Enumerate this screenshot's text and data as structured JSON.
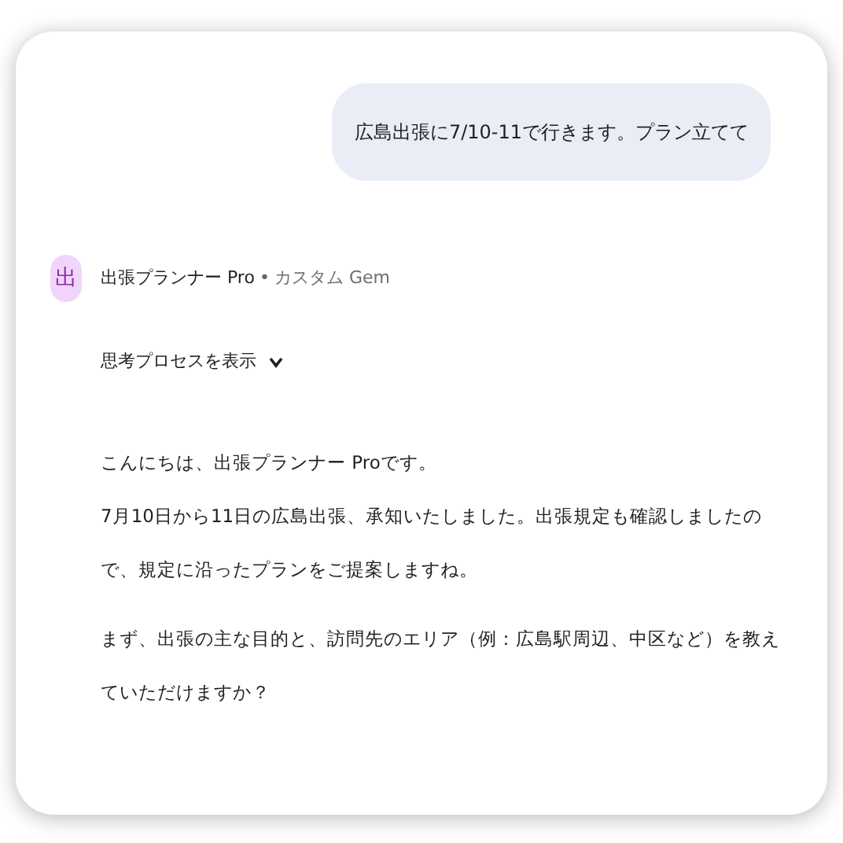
{
  "user_message": {
    "text": "広島出張に7/10-11で行きます。プラン立てて"
  },
  "assistant": {
    "avatar": "出",
    "name": "出張プランナー Pro",
    "separator": "•",
    "subtitle": "カスタム Gem"
  },
  "thinking_toggle": {
    "label": "思考プロセスを表示",
    "expanded": false
  },
  "response": [
    {
      "lines": [
        "こんにちは、出張プランナー Proです。",
        "7月10日から11日の広島出張、承知いたしました。出張規定も確認しましたので、規定に沿ったプランをご提案しますね。"
      ]
    },
    {
      "lines": [
        "まず、出張の主な目的と、訪問先のエリア（例：広島駅周辺、中区など）を教えていただけますか？"
      ]
    }
  ]
}
